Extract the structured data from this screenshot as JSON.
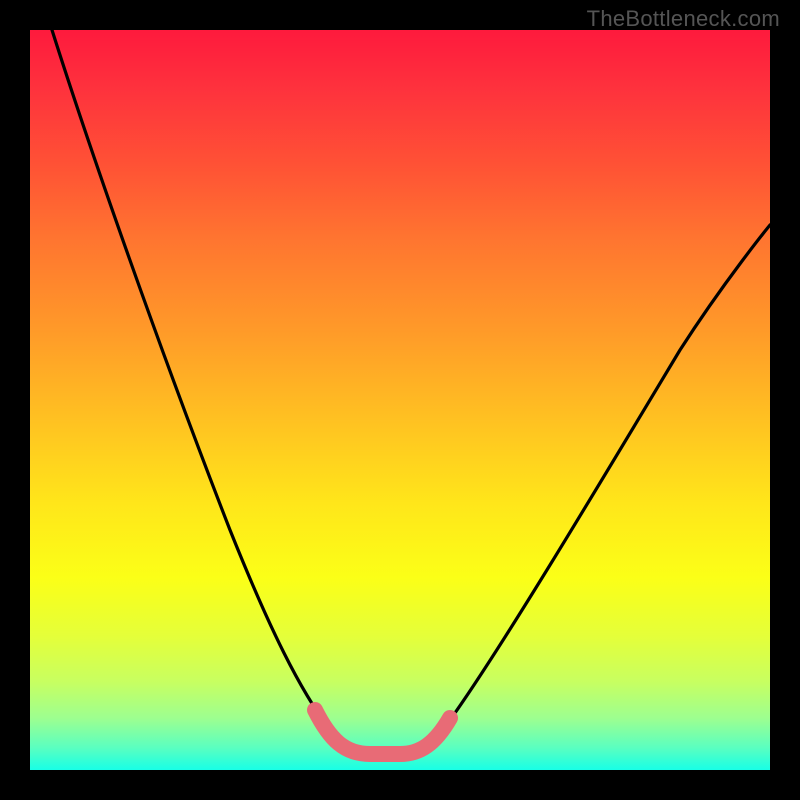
{
  "watermark": "TheBottleneck.com",
  "chart_data": {
    "type": "line",
    "title": "",
    "xlabel": "",
    "ylabel": "",
    "xlim": [
      0,
      100
    ],
    "ylim": [
      0,
      100
    ],
    "series": [
      {
        "name": "bottleneck-curve",
        "x": [
          3,
          10,
          20,
          28,
          34,
          38,
          40,
          42,
          44,
          46,
          50,
          54,
          58,
          66,
          76,
          88,
          100
        ],
        "values": [
          100,
          78,
          50,
          30,
          16,
          8,
          4,
          2.5,
          2.5,
          2.5,
          2.5,
          4,
          8,
          20,
          38,
          58,
          72
        ]
      },
      {
        "name": "highlight-band",
        "x": [
          38,
          40,
          42,
          44,
          46,
          48,
          50,
          52,
          54
        ],
        "values": [
          7,
          4,
          2.5,
          2.5,
          2.5,
          2.5,
          2.5,
          4,
          7
        ]
      }
    ],
    "gradient_stops": [
      {
        "pos": 0,
        "color": "#fe1a3d"
      },
      {
        "pos": 50,
        "color": "#ffc020"
      },
      {
        "pos": 100,
        "color": "#18ffe6"
      }
    ]
  }
}
